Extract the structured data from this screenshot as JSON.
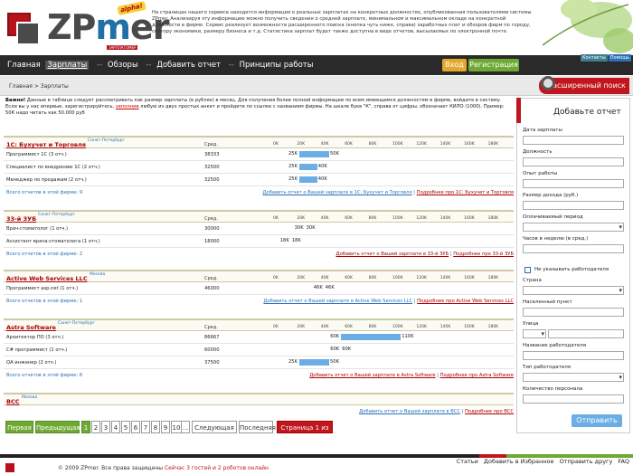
{
  "logo": {
    "text_a": "ZP",
    "text_m": "m",
    "text_b": "er",
    "alpha": "alpha!",
    "sub": "ЗАРПЛАТОМЕР"
  },
  "intro": "На страницах нашего сервиса находится информация о реальных зарплатах на конкретных должностях, опубликованная пользователями системы ZPmer. Анализируя эту информацию можно получить сведения о средней зарплате, минимальном и максимальном окладе на конкретной должности в фирме. Сервис реализует возможности расширенного поиска (кнопка чуть ниже, справа) заработных плат и обзоров фирм по городу, сектору экономики, размеру бизнеса и т.д. Статистика зарплат будет также доступна в виде отчетов, высылаемых по электронной почте.",
  "mini_tabs": {
    "contacts": "Контакты",
    "help": "Помощь"
  },
  "nav": {
    "home": "Главная",
    "salaries": "Зарплаты",
    "reviews": "Обзоры",
    "add_report": "Добавить отчет",
    "principles": "Принципы работы",
    "sep": "--"
  },
  "auth": {
    "login": "Вход",
    "register": "Регистрация"
  },
  "breadcrumb": "Главная > Зарплаты",
  "advanced_search": "Расширенный поиск",
  "note": {
    "bold": "Важно!",
    "text": "Данные в таблице следует рассматривать как размер зарплаты (в рублях) в месяц. Для получения более полной информации по всем имеющимся должностям в фирме, войдите в систему. Если вы у нас впервые, зарегистрируйтесь,",
    "link": "заполнив",
    "text2": "любую из двух простых анкет и пройдите по ссылке с названием фирмы. На шкале букв \"К\", справа от цифры, обозначает КИЛО (1000). Пример: 50К надо читать как 50.000 руб"
  },
  "scale_labels": [
    "0K",
    "20K",
    "40K",
    "60K",
    "80K",
    "100K",
    "120K",
    "140K",
    "160K",
    "180K"
  ],
  "col_avg": "Сред.",
  "companies": [
    {
      "name": "1С: Бухучет и Торговля",
      "city": "Санкт-Петербург",
      "rows": [
        {
          "pos": "Программист 1С (3 отч.)",
          "avg": "38333",
          "min": "25K",
          "max": "50K"
        },
        {
          "pos": "Специалист по внедрению 1С (2 отч.)",
          "avg": "32500",
          "min": "25K",
          "max": "40K"
        },
        {
          "pos": "Менеджер по продажам (2 отч.)",
          "avg": "32500",
          "min": "25K",
          "max": "40K"
        }
      ],
      "all": "Всего отчетов в этой фирме: 9",
      "add": "Добавить отчет о Вашей зарплате в 1С: Бухучет и Торговля",
      "more": "Подробнее про 1С: Бухучет и Торговля"
    },
    {
      "name": "33-й ЗУБ",
      "city": "Санкт-Петербург",
      "rows": [
        {
          "pos": "Врач-стоматолог (1 отч.)",
          "avg": "30000",
          "min": "30K",
          "max": "30K"
        },
        {
          "pos": "Ассистент врача-стоматолога (1 отч.)",
          "avg": "18000",
          "min": "18K",
          "max": "18K"
        }
      ],
      "all": "Всего отчетов в этой фирме: 2",
      "add": "Добавить отчет о Вашей зарплате в 33-й ЗУБ",
      "more": "Подробнее про 33-й ЗУБ"
    },
    {
      "name": "Active Web Services LLC",
      "city": "Москва",
      "rows": [
        {
          "pos": "Программист asp.net (1 отч.)",
          "avg": "46000",
          "min": "46K",
          "max": "46K"
        }
      ],
      "all": "Всего отчетов в этой фирме: 1",
      "add": "Добавить отчет о Вашей зарплате в Active Web Services LLC",
      "more": "Подробнее про Active Web Services LLC"
    },
    {
      "name": "Astra Software",
      "city": "Санкт-Петербург",
      "rows": [
        {
          "pos": "Архитектор ПО (3 отч.)",
          "avg": "86667",
          "min": "60K",
          "max": "110K"
        },
        {
          "pos": "C# программист (1 отч.)",
          "avg": "60000",
          "min": "60K",
          "max": "60K"
        },
        {
          "pos": "QA инженер (2 отч.)",
          "avg": "37500",
          "min": "25K",
          "max": "50K"
        }
      ],
      "all": "Всего отчетов в этой фирме: 6",
      "add": "Добавить отчет о Вашей зарплате в Astra Software",
      "more": "Подробнее про Astra Software"
    },
    {
      "name": "BCC",
      "city": "Москва",
      "rows": [],
      "all": "",
      "add": "Добавить отчет о Вашей зарплате в BCC",
      "more": "Подробнее про BCC"
    }
  ],
  "sidebar": {
    "title": "Добавьте отчет",
    "fields": [
      "Дата зарплаты",
      "Должность",
      "Опыт работы",
      "Размер дохода (руб.)",
      "Оплачиваемый период",
      "Часов в неделю (в сред.)"
    ],
    "no_employer": "Не указывать работодателя",
    "fields2": [
      "Страна",
      "Населенный пункт",
      "Улица",
      "Название работодателя",
      "Тип работодателя",
      "Количество персонала"
    ],
    "send": "Отправить"
  },
  "pager": {
    "first": "Первая",
    "prev": "Предыдущая",
    "pages": [
      "1",
      "2",
      "3",
      "4",
      "5",
      "6",
      "7",
      "8",
      "9",
      "10"
    ],
    "dots": "...",
    "next": "Следующая",
    "last": "Последняя",
    "info": "Страница 1 из 53"
  },
  "footer": {
    "copy": "© 2009 ZPmer. Все права защищены",
    "online": "Сейчас 3 гостей и 2 роботов онлайн",
    "links": [
      "Статьи",
      "Добавить в Избранное",
      "Отправить другу",
      "FAQ"
    ]
  }
}
